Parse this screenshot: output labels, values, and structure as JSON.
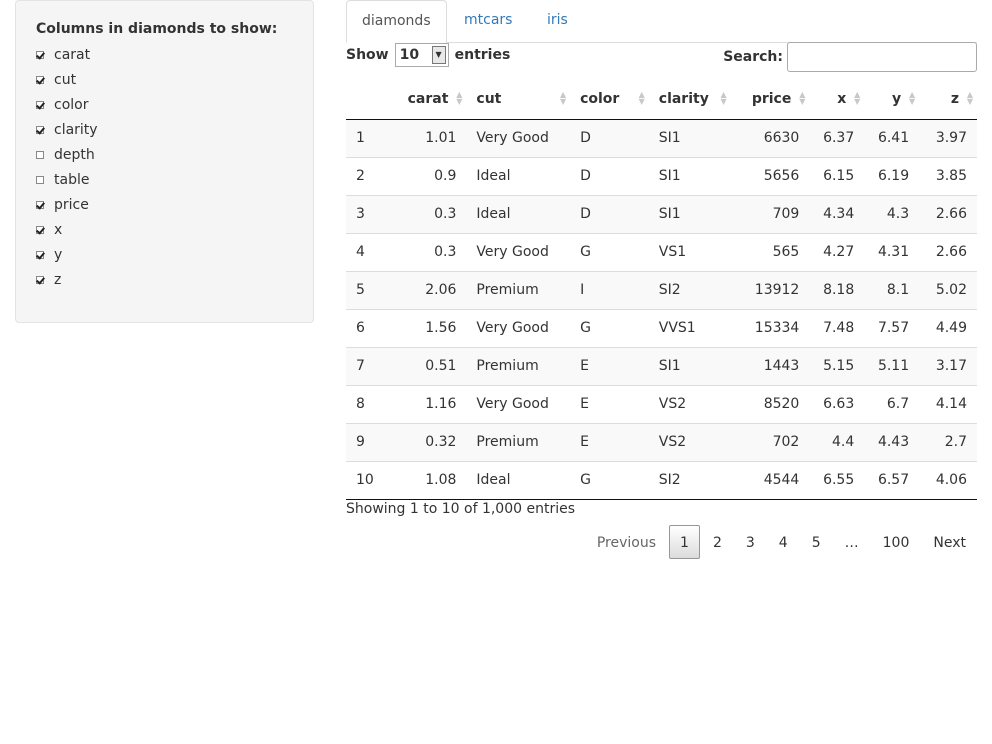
{
  "sidebar": {
    "title": "Columns in diamonds to show:",
    "checkboxes": [
      {
        "label": "carat",
        "checked": true
      },
      {
        "label": "cut",
        "checked": true
      },
      {
        "label": "color",
        "checked": true
      },
      {
        "label": "clarity",
        "checked": true
      },
      {
        "label": "depth",
        "checked": false
      },
      {
        "label": "table",
        "checked": false
      },
      {
        "label": "price",
        "checked": true
      },
      {
        "label": "x",
        "checked": true
      },
      {
        "label": "y",
        "checked": true
      },
      {
        "label": "z",
        "checked": true
      }
    ]
  },
  "tabs": [
    {
      "label": "diamonds",
      "active": true
    },
    {
      "label": "mtcars",
      "active": false
    },
    {
      "label": "iris",
      "active": false
    }
  ],
  "length_menu": {
    "prefix": "Show",
    "value": "10",
    "suffix": "entries"
  },
  "search": {
    "label": "Search:",
    "value": ""
  },
  "table": {
    "headers": [
      "",
      "carat",
      "cut",
      "color",
      "clarity",
      "price",
      "x",
      "y",
      "z"
    ],
    "rows": [
      [
        "1",
        "1.01",
        "Very Good",
        "D",
        "SI1",
        "6630",
        "6.37",
        "6.41",
        "3.97"
      ],
      [
        "2",
        "0.9",
        "Ideal",
        "D",
        "SI1",
        "5656",
        "6.15",
        "6.19",
        "3.85"
      ],
      [
        "3",
        "0.3",
        "Ideal",
        "D",
        "SI1",
        "709",
        "4.34",
        "4.3",
        "2.66"
      ],
      [
        "4",
        "0.3",
        "Very Good",
        "G",
        "VS1",
        "565",
        "4.27",
        "4.31",
        "2.66"
      ],
      [
        "5",
        "2.06",
        "Premium",
        "I",
        "SI2",
        "13912",
        "8.18",
        "8.1",
        "5.02"
      ],
      [
        "6",
        "1.56",
        "Very Good",
        "G",
        "VVS1",
        "15334",
        "7.48",
        "7.57",
        "4.49"
      ],
      [
        "7",
        "0.51",
        "Premium",
        "E",
        "SI1",
        "1443",
        "5.15",
        "5.11",
        "3.17"
      ],
      [
        "8",
        "1.16",
        "Very Good",
        "E",
        "VS2",
        "8520",
        "6.63",
        "6.7",
        "4.14"
      ],
      [
        "9",
        "0.32",
        "Premium",
        "E",
        "VS2",
        "702",
        "4.4",
        "4.43",
        "2.7"
      ],
      [
        "10",
        "1.08",
        "Ideal",
        "G",
        "SI2",
        "4544",
        "6.55",
        "6.57",
        "4.06"
      ]
    ]
  },
  "info": "Showing 1 to 10 of 1,000 entries",
  "pagination": {
    "previous": "Previous",
    "pages": [
      "1",
      "2",
      "3",
      "4",
      "5",
      "…",
      "100"
    ],
    "current": "1",
    "next": "Next"
  },
  "colors": {
    "link": "#337ab7",
    "stripe": "#f9f9f9",
    "panel": "#f5f5f5"
  }
}
